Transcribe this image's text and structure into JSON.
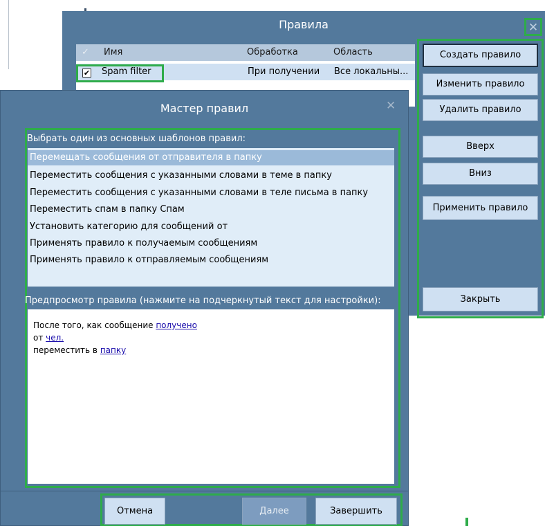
{
  "rules_window": {
    "title": "Правила",
    "columns": [
      "Имя",
      "Обработка",
      "Область"
    ],
    "rows": [
      {
        "checked": true,
        "name": "Spam filter",
        "processing": "При получении",
        "scope": "Все локальны..."
      }
    ],
    "buttons": {
      "create": "Создать правило",
      "edit": "Изменить правило",
      "delete": "Удалить правило",
      "up": "Вверх",
      "down": "Вниз",
      "apply": "Применить правило",
      "close": "Закрыть"
    }
  },
  "wizard": {
    "title": "Мастер правил",
    "templates_label": "Выбрать один из основных шаблонов правил:",
    "templates": [
      "Перемещать сообщения от отправителя в папку",
      "Переместить сообщения с указанными словами в теме в папку",
      "Переместить сообщения с указанными словами в теле письма в папку",
      "Переместить спам в папку Спам",
      "Установить категорию для сообщений от",
      "Применять правило к получаемым сообщениям",
      "Применять правило к отправляемым сообщениям"
    ],
    "selected_template": 0,
    "preview_label": "Предпросмотр правила (нажмите на подчеркнутый текст для настройки):",
    "preview": {
      "line1_text": "После того, как сообщение ",
      "line1_link": "получено",
      "line2_text": "от ",
      "line2_link": "чел.",
      "line3_text": "переместить в ",
      "line3_link": "папку"
    },
    "buttons": {
      "cancel": "Отмена",
      "next": "Далее",
      "finish": "Завершить"
    }
  },
  "icons": {
    "close": "✕",
    "check": "✓",
    "checkbox_checked": "✔"
  },
  "colors": {
    "window_bg": "#53799c",
    "button_bg": "#cfe0f2",
    "highlight": "#2eac4a"
  }
}
